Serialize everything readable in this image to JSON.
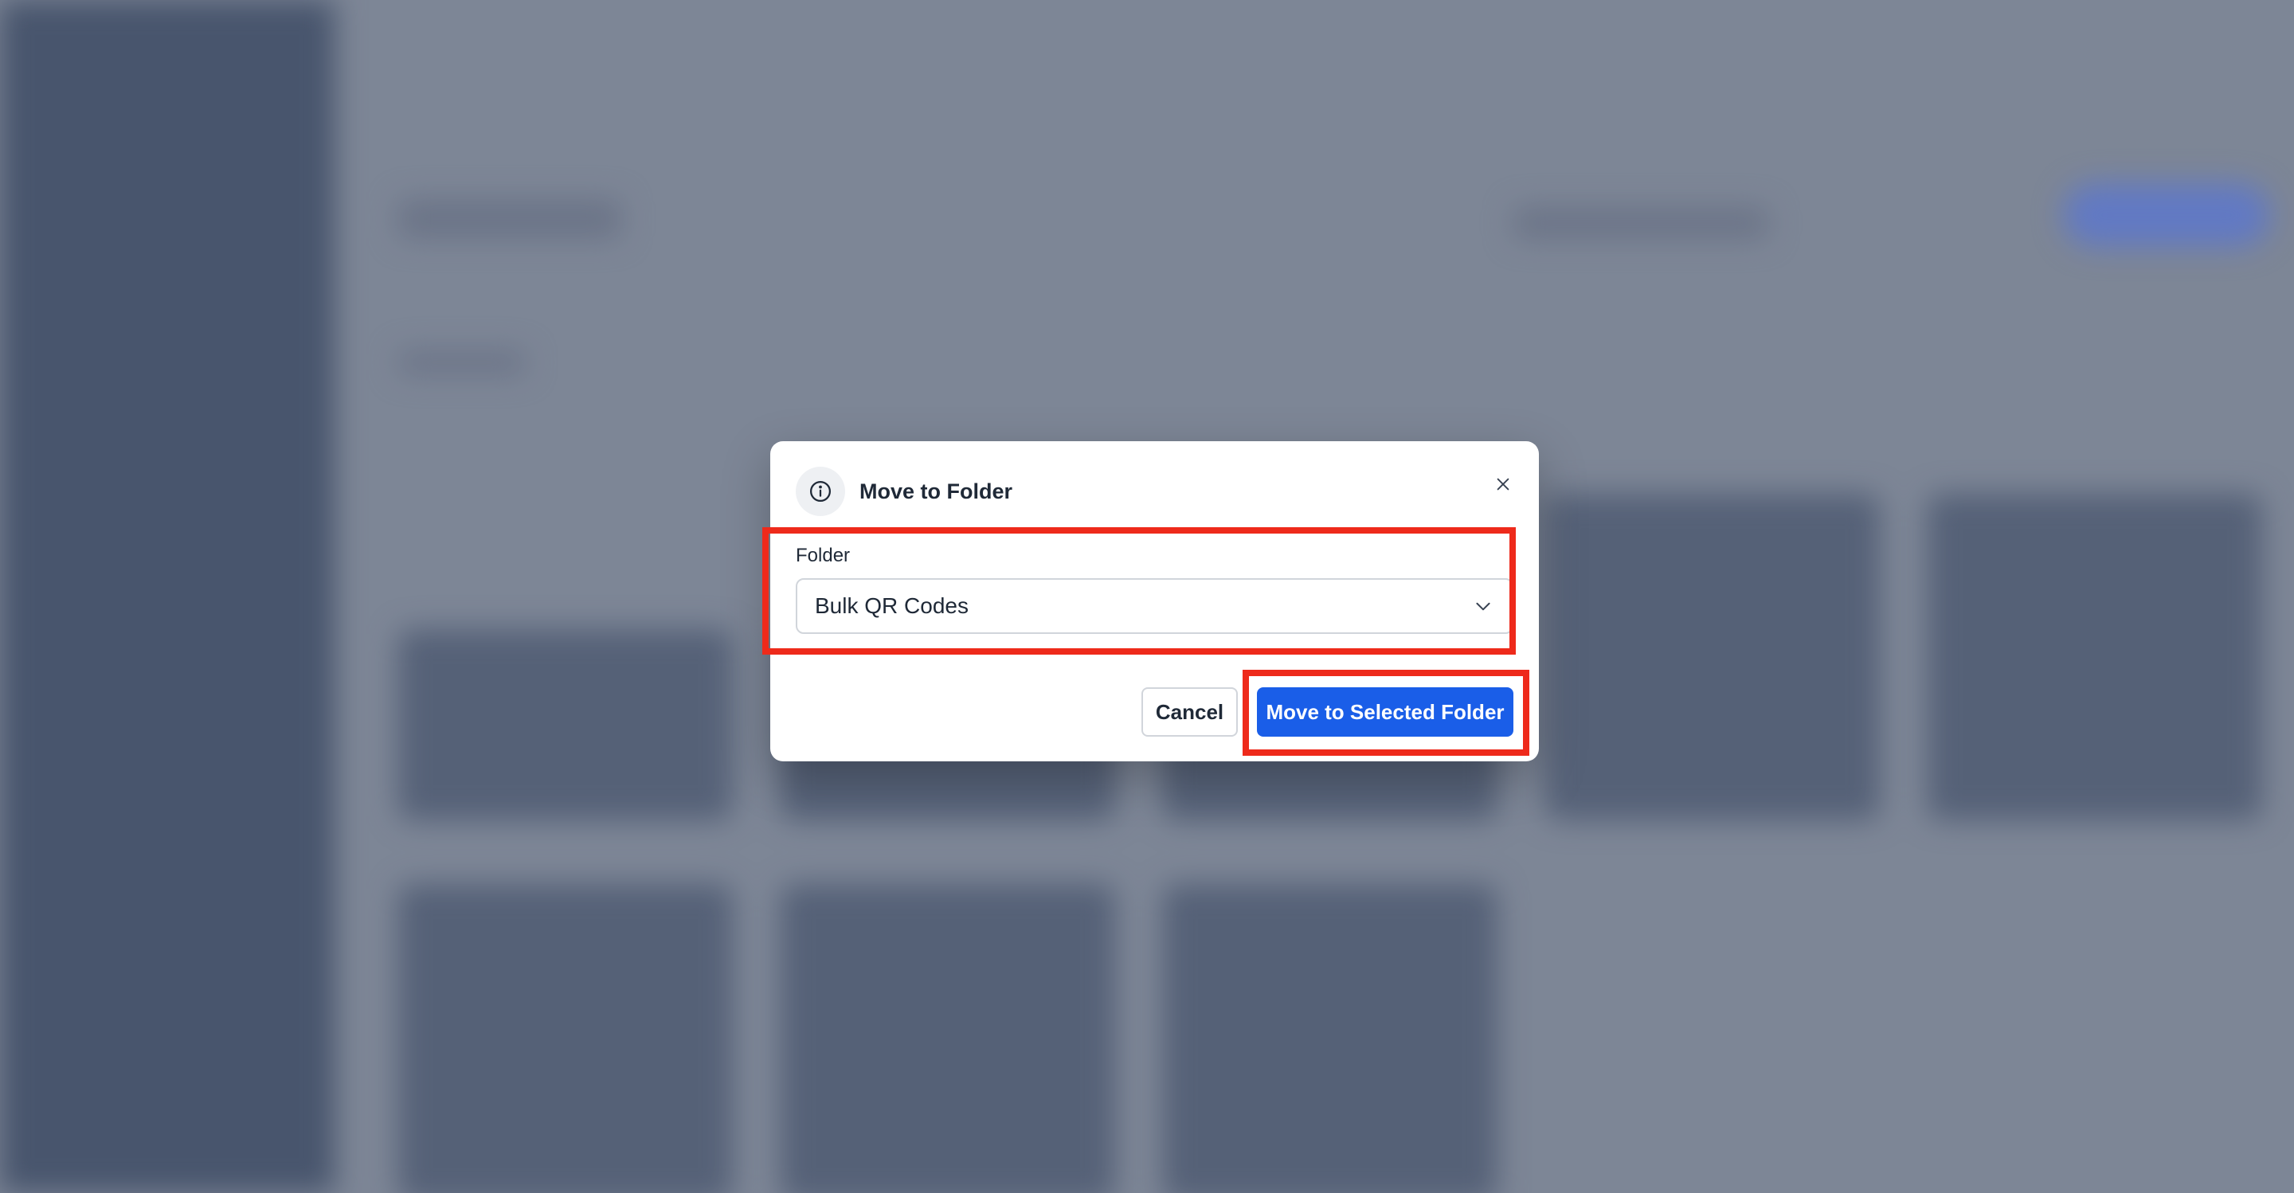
{
  "modal": {
    "title": "Move to Folder",
    "title_icon": "info-icon",
    "close_icon": "close-icon",
    "folder_label": "Folder",
    "folder_selected": "Bulk QR Codes",
    "select_icon": "chevron-down-icon",
    "cancel_label": "Cancel",
    "move_label": "Move to Selected Folder"
  },
  "colors": {
    "primary": "#1a5ee8",
    "highlight": "#ee2a1b",
    "sidebar": "#3b4a63",
    "backdrop": "#828b9a"
  }
}
